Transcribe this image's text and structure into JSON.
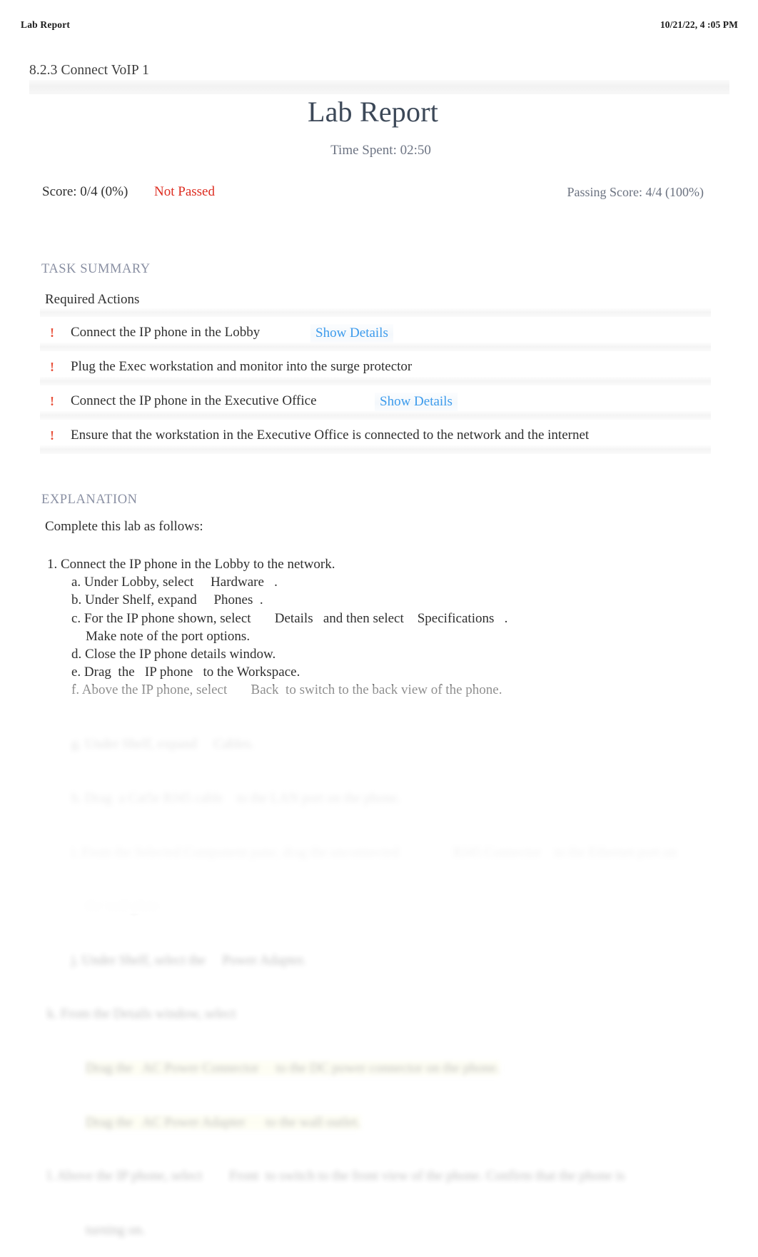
{
  "print_header": {
    "left_label": "Lab Report",
    "timestamp": "10/21/22, 4 :05 PM"
  },
  "lab": {
    "id_title": "8.2.3 Connect VoIP 1",
    "report_title": "Lab Report",
    "time_spent": "Time Spent: 02:50"
  },
  "score": {
    "score_text": "Score: 0/4 (0%)",
    "status": "Not Passed",
    "status_color": "#dd2c20",
    "passing_score": "Passing Score: 4/4 (100%)"
  },
  "task_summary": {
    "heading": "TASK SUMMARY",
    "subheading": "Required Actions",
    "marker": "!",
    "marker_color": "#e8503a",
    "link_color": "#3d9bec",
    "actions": [
      {
        "text": "Connect the IP phone in the Lobby",
        "details_label": "Show Details",
        "has_details": true
      },
      {
        "text": "Plug the Exec workstation and monitor into the surge protector",
        "details_label": "",
        "has_details": false
      },
      {
        "text": "Connect the IP phone in the Executive Office",
        "details_label": "Show Details",
        "has_details": true
      },
      {
        "text": "Ensure that the workstation in the Executive Office is connected to the network and the internet",
        "details_label": "",
        "has_details": false
      }
    ]
  },
  "explanation": {
    "heading": "EXPLANATION",
    "intro": "Complete this lab as follows:",
    "steps": [
      "1. Connect the IP phone in the Lobby to the network.",
      "a. Under Lobby, select     Hardware   .",
      "b. Under Shelf, expand     Phones  .",
      "c. For the IP phone shown, select       Details   and then select    Specifications   .",
      "Make note of the port options.",
      "d. Close the IP phone details window.",
      "e. Drag  the   IP phone   to the Workspace.",
      "f. Above the IP phone, select       Back  to switch to the back view of the phone."
    ],
    "blurred_lines": [
      "g. Under Shelf, expand     Cables.",
      "h. Drag  a Cat5e RJ45 cable    to the LAN port on the phone.",
      "i. From the Selected Component pane, drag the unconnected                RJ45 Connector    to the Ethernet port on",
      "the wall plate.",
      "j. Under Shelf, select the     Power Adapter.",
      "k. From the Details window, select",
      "Drag the   AC Power Connector     to the DC power connector on the phone.",
      "Drag the   AC Power Adapter      to the wall outlet.",
      "l. Above the IP phone, select        Front  to switch to the front view of the phone. Confirm that the phone is",
      "turning on."
    ]
  }
}
